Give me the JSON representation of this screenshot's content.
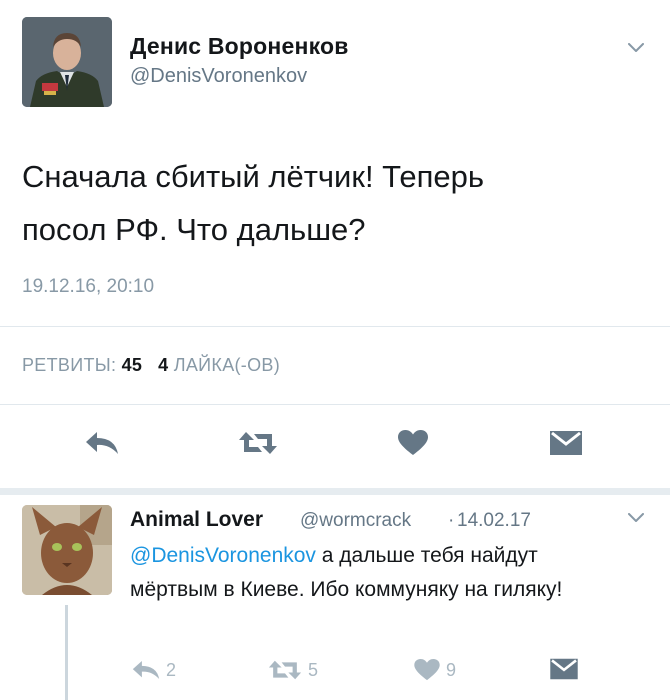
{
  "tweet": {
    "display_name": "Денис Вороненков",
    "handle": "@DenisVoronenkov",
    "text_line1": "Сначала сбитый лётчик! Теперь",
    "text_line2": "посол РФ. Что дальше?",
    "timestamp": "19.12.16, 20:10",
    "retweets_label": "РЕТВИТЫ:",
    "retweets_count": "45",
    "likes_count": "4",
    "likes_label": "ЛАЙКА(-ОВ)"
  },
  "reply": {
    "display_name": "Animal Lover",
    "handle": "@wormcrack",
    "separator": "·",
    "date": "14.02.17",
    "mention": "@DenisVoronenkov",
    "text_rest": " а дальше тебя найдут мёртвым в Киеве. Ибо коммуняку на гиляку!",
    "reply_count": "2",
    "retweet_count": "5",
    "like_count": "9"
  },
  "colors": {
    "primary_text": "#14171a",
    "secondary_text": "#657786",
    "muted_text": "#8899a6",
    "action_icon": "#657786",
    "mention": "#1b95e0",
    "divider": "#e1e8ed"
  },
  "icons": [
    "chevron-down-icon",
    "reply-icon",
    "retweet-icon",
    "heart-icon",
    "direct-message-icon"
  ]
}
